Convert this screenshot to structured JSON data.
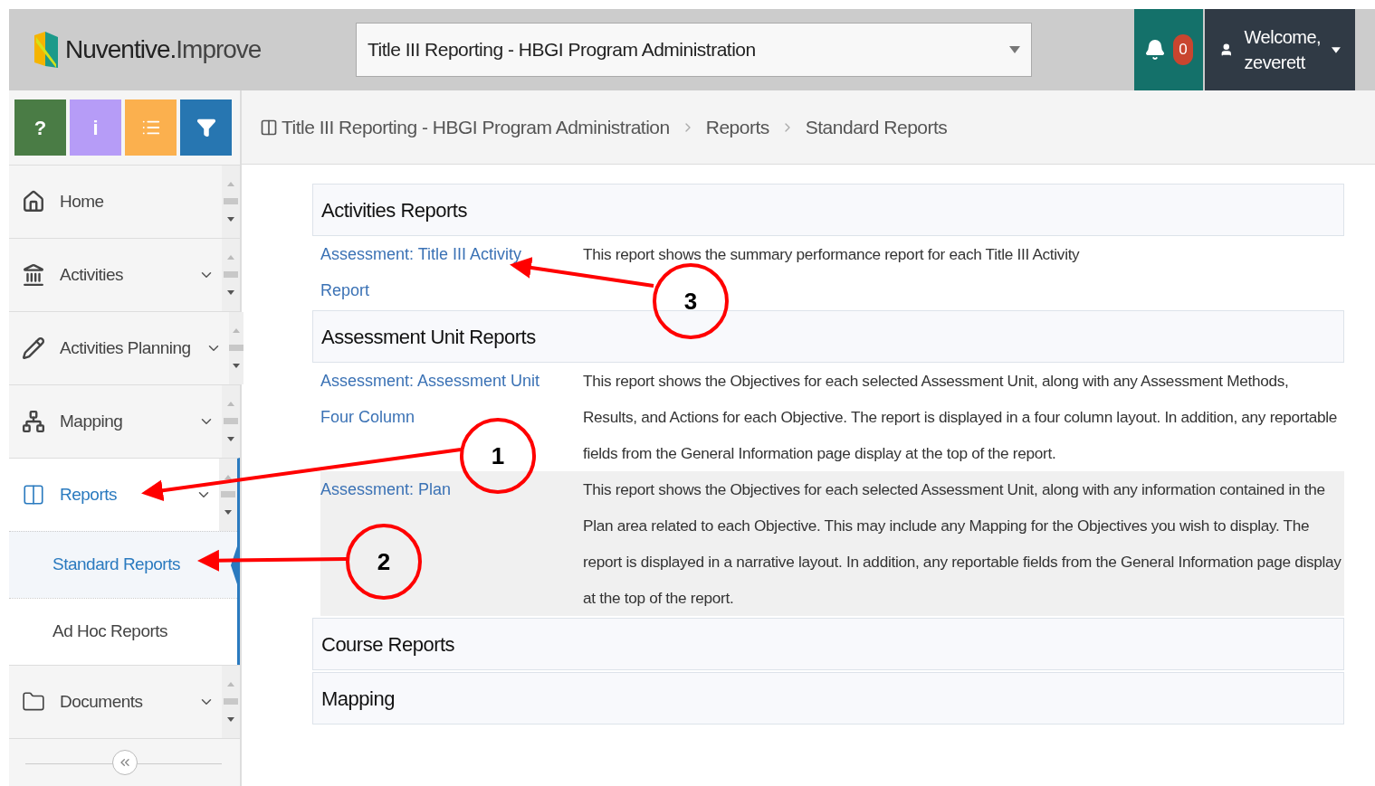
{
  "header": {
    "logo": {
      "brand": "Nuventive.",
      "product": "Improve"
    },
    "project_select": {
      "value": "Title III Reporting - HBGI Program Administration"
    },
    "notifications": {
      "count": "0"
    },
    "user": {
      "greeting": "Welcome,",
      "name": "zeverett"
    }
  },
  "toolbar": [
    {
      "kind": "help",
      "glyph": "?"
    },
    {
      "kind": "info",
      "glyph": "i"
    },
    {
      "kind": "notes"
    },
    {
      "kind": "filter"
    }
  ],
  "breadcrumb": [
    "Title III Reporting - HBGI Program Administration",
    "Reports",
    "Standard Reports"
  ],
  "sidebar": {
    "items": [
      {
        "kind": "home",
        "label": "Home",
        "expandable": false,
        "selected": false
      },
      {
        "kind": "activities",
        "label": "Activities",
        "expandable": true,
        "selected": false
      },
      {
        "kind": "planning",
        "label": "Activities Planning",
        "expandable": true,
        "selected": false
      },
      {
        "kind": "mapping",
        "label": "Mapping",
        "expandable": true,
        "selected": false
      },
      {
        "kind": "reports",
        "label": "Reports",
        "expandable": true,
        "selected": true,
        "children": [
          {
            "label": "Standard Reports",
            "selected": true
          },
          {
            "label": "Ad Hoc Reports",
            "selected": false
          }
        ]
      },
      {
        "kind": "documents",
        "label": "Documents",
        "expandable": true,
        "selected": false
      }
    ]
  },
  "sections": [
    {
      "title": "Activities Reports",
      "rows": [
        {
          "link": "Assessment: Title III Activity Report",
          "description": "This report shows the summary performance report for each Title III Activity",
          "highlighted": false
        }
      ]
    },
    {
      "title": "Assessment Unit Reports",
      "rows": [
        {
          "link": "Assessment: Assessment Unit Four Column",
          "description": "This report shows the Objectives for each selected Assessment Unit, along with any Assessment Methods, Results, and Actions for each Objective. The report is displayed in a four column layout. In addition, any reportable fields from the General Information page display at the top of the report.",
          "highlighted": false
        },
        {
          "link": "Assessment: Plan",
          "description": "This report shows the Objectives for each selected Assessment Unit, along with any information contained in the Plan area related to each Objective. This may include any Mapping for the Objectives you wish to display. The report is displayed in a narrative layout. In addition, any reportable fields from the General Information page display at the top of the report.",
          "highlighted": true
        }
      ]
    },
    {
      "title": "Course Reports"
    },
    {
      "title": "Mapping"
    }
  ],
  "annotations": [
    {
      "number": "1"
    },
    {
      "number": "2"
    },
    {
      "number": "3"
    }
  ]
}
